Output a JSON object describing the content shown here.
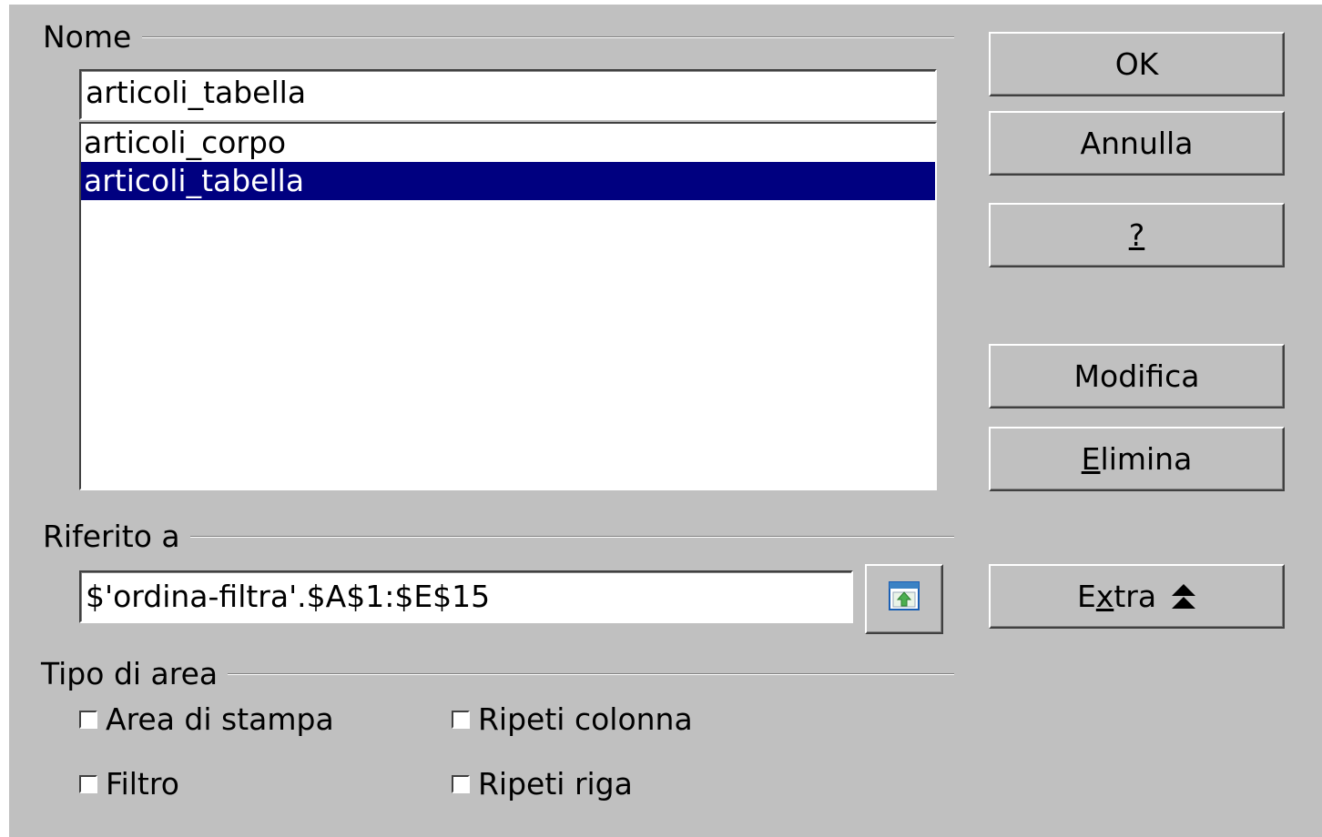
{
  "name_section": {
    "label": "Nome",
    "input_value": "articoli_tabella",
    "list_items": [
      {
        "label": "articoli_corpo",
        "selected": false
      },
      {
        "label": "articoli_tabella",
        "selected": true
      }
    ]
  },
  "ref_section": {
    "label": "Riferito a",
    "input_value": "$'ordina-filtra'.$A$1:$E$15",
    "shrink_button_icon": "shrink-dialog-icon"
  },
  "area_type_section": {
    "label": "Tipo di area",
    "options": {
      "print_area": {
        "label": "Area di stampa",
        "checked": false
      },
      "repeat_column": {
        "label": "Ripeti colonna",
        "checked": false
      },
      "filter": {
        "label": "Filtro",
        "checked": false
      },
      "repeat_row": {
        "label": "Ripeti riga",
        "checked": false
      }
    }
  },
  "buttons": {
    "ok": "OK",
    "cancel": "Annulla",
    "help": "?",
    "modify": "Modifica",
    "delete_first": "E",
    "delete_rest": "limina",
    "extra_before": "E",
    "extra_mnemonic": "x",
    "extra_after": "tra",
    "extra_icon": "double-chevron-up-icon"
  },
  "colors": {
    "dialog_bg": "#c0c0c0",
    "selection_bg": "#000080",
    "selection_fg": "#ffffff"
  }
}
